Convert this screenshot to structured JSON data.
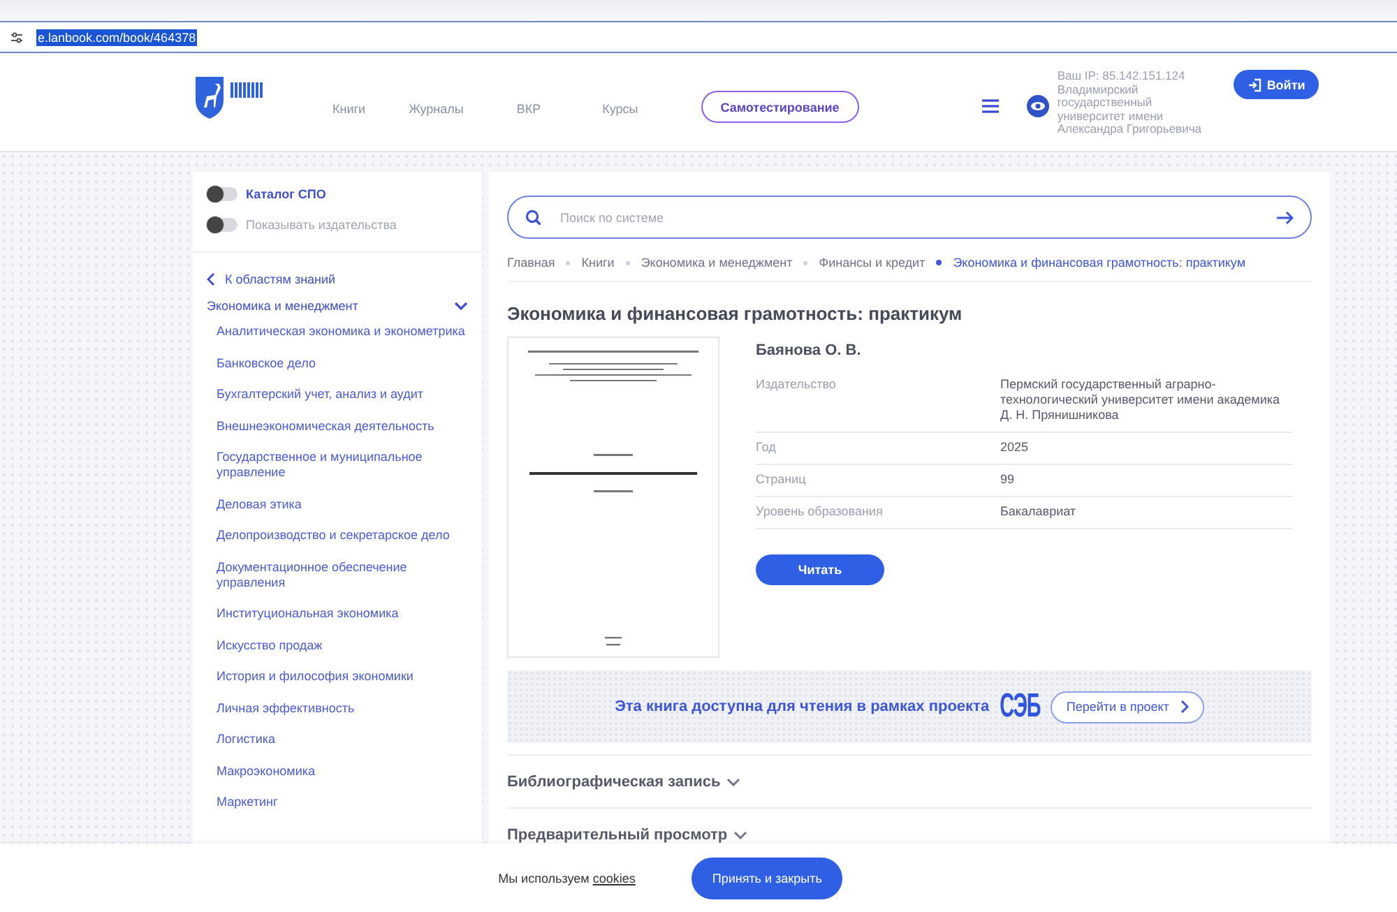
{
  "address_bar": {
    "url": "e.lanbook.com/book/464378"
  },
  "header": {
    "nav": [
      {
        "label": "Книги"
      },
      {
        "label": "Журналы"
      },
      {
        "label": "ВКР"
      },
      {
        "label": "Курсы"
      }
    ],
    "self_test_button": "Самотестирование",
    "ip": "Ваш IP: 85.142.151.124",
    "institution": "Владимирский государственный университет имени Александра Григорьевича",
    "login_button": "Войти"
  },
  "sidebar": {
    "toggles": [
      {
        "label": "Каталог СПО",
        "on": false,
        "disabled": false
      },
      {
        "label": "Показывать издательства",
        "on": false,
        "disabled": true
      }
    ],
    "back_link": "К областям знаний",
    "category": {
      "label": "Экономика и менеджмент",
      "expanded": true,
      "children": [
        {
          "label": "Аналитическая экономика и эконометрика"
        },
        {
          "label": "Банковское дело"
        },
        {
          "label": "Бухгалтерский учет, анализ и аудит"
        },
        {
          "label": "Внешнеэкономическая деятельность"
        },
        {
          "label": "Государственное и муниципальное управление"
        },
        {
          "label": "Деловая этика"
        },
        {
          "label": "Делопроизводство и секретарское дело"
        },
        {
          "label": "Документационное обеспечение управления"
        },
        {
          "label": "Институциональная экономика"
        },
        {
          "label": "Искусство продаж"
        },
        {
          "label": "История и философия экономики"
        },
        {
          "label": "Личная эффективность"
        },
        {
          "label": "Логистика"
        },
        {
          "label": "Макроэкономика"
        },
        {
          "label": "Маркетинг"
        }
      ]
    }
  },
  "search": {
    "placeholder": "Поиск по системе"
  },
  "breadcrumbs": [
    {
      "label": "Главная",
      "selected": false
    },
    {
      "label": "Книги",
      "selected": false
    },
    {
      "label": "Экономика и менеджмент",
      "selected": false
    },
    {
      "label": "Финансы и кредит",
      "selected": false
    },
    {
      "label": "Экономика и финансовая грамотность: практикум",
      "selected": true
    }
  ],
  "book": {
    "title": "Экономика и финансовая грамотность: практикум",
    "author": "Баянова О. В.",
    "details": [
      {
        "label": "Издательство",
        "value": "Пермский государственный аграрно-технологический университет имени академика Д. Н. Прянишникова"
      },
      {
        "label": "Год",
        "value": "2025"
      },
      {
        "label": "Страниц",
        "value": "99"
      },
      {
        "label": "Уровень образования",
        "value": "Бакалавриат"
      }
    ],
    "read_button": "Читать"
  },
  "project_banner": {
    "text": "Эта книга доступна для чтения в рамках проекта",
    "logo": "СЭБ",
    "button": "Перейти в проект"
  },
  "sections": [
    {
      "label": "Библиографическая запись",
      "expanded": false
    },
    {
      "label": "Предварительный просмотр",
      "expanded": false
    }
  ],
  "cookie_bar": {
    "text": "Мы используем",
    "link": "cookies",
    "button": "Принять и закрыть"
  }
}
